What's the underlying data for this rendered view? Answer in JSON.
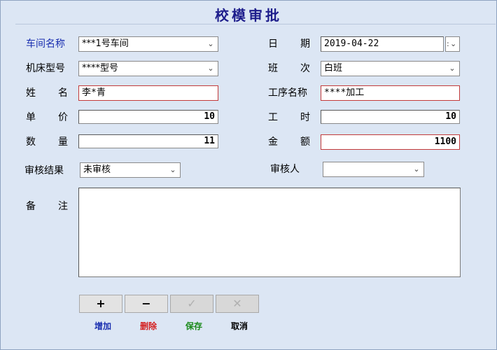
{
  "window": {
    "title": "校模审批"
  },
  "form": {
    "workshop": {
      "label": "车间名称",
      "value": "***1号车间"
    },
    "date": {
      "label_chars": [
        "日",
        "期"
      ],
      "value": "2019-04-22"
    },
    "machine": {
      "label": "机床型号",
      "value": "****型号"
    },
    "shift": {
      "label_chars": [
        "班",
        "次"
      ],
      "value": "白班"
    },
    "name": {
      "label_chars": [
        "姓",
        "名"
      ],
      "value": "李*青"
    },
    "process": {
      "label": "工序名称",
      "value": "****加工"
    },
    "unit_price": {
      "label_chars": [
        "单",
        "价"
      ],
      "value": "10"
    },
    "hours": {
      "label_chars": [
        "工",
        "时"
      ],
      "value": "10"
    },
    "quantity": {
      "label_chars": [
        "数",
        "量"
      ],
      "value": "11"
    },
    "amount": {
      "label_chars": [
        "金",
        "额"
      ],
      "value": "1100"
    },
    "review_result": {
      "label": "审核结果",
      "value": "未审核"
    },
    "reviewer": {
      "label": "审核人",
      "value": ""
    },
    "remark": {
      "label_chars": [
        "备",
        "注"
      ],
      "value": ""
    }
  },
  "toolbar": {
    "add_symbol": "+",
    "delete_symbol": "−",
    "save_symbol": "✓",
    "cancel_symbol": "✕",
    "add_label": "增加",
    "delete_label": "删除",
    "save_label": "保存",
    "cancel_label": "取消"
  },
  "colors": {
    "background": "#dce6f4",
    "title": "#1e1e8c",
    "accent_label": "#1a2fb0",
    "required_border": "#c23a3a",
    "add": "#1a2fb0",
    "delete": "#d42020",
    "save": "#1a8a1a",
    "cancel": "#000000"
  },
  "icons": {
    "combo_arrow": "chevron-down-icon",
    "date_picker": "spin-icon"
  }
}
